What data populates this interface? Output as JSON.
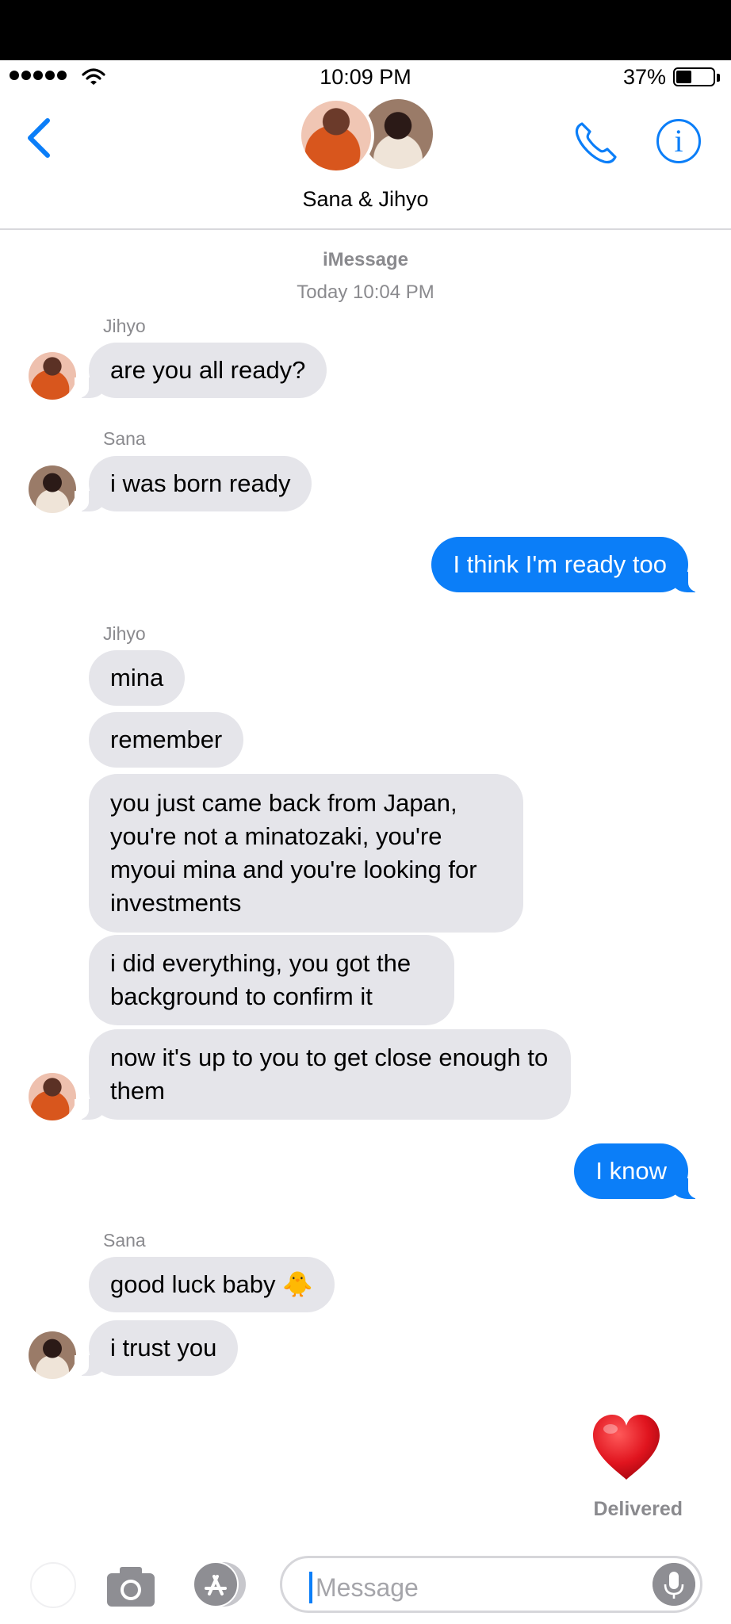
{
  "status_bar": {
    "time": "10:09 PM",
    "battery": "37%",
    "battery_level": 0.37
  },
  "nav": {
    "thread_name": "Sana & Jihyo"
  },
  "conversation": {
    "service": "iMessage",
    "timestamp": "Today 10:04 PM"
  },
  "messages": [
    {
      "sender": "Jihyo",
      "direction": "incoming",
      "text": "are you all ready?"
    },
    {
      "sender": "Sana",
      "direction": "incoming",
      "text": "i was born ready"
    },
    {
      "sender": "Me",
      "direction": "outgoing",
      "text": "I think I'm ready too"
    },
    {
      "sender": "Jihyo",
      "direction": "incoming",
      "text": "mina"
    },
    {
      "sender": "Jihyo",
      "direction": "incoming",
      "text": "remember"
    },
    {
      "sender": "Jihyo",
      "direction": "incoming",
      "text": "you just came back from Japan, you're not a minatozaki, you're myoui mina and you're looking for investments"
    },
    {
      "sender": "Jihyo",
      "direction": "incoming",
      "text": "i did everything, you got the background to confirm it"
    },
    {
      "sender": "Jihyo",
      "direction": "incoming",
      "text": "now it's up to you to get close enough to them"
    },
    {
      "sender": "Me",
      "direction": "outgoing",
      "text": "I know"
    },
    {
      "sender": "Sana",
      "direction": "incoming",
      "text": "good luck baby 🐥"
    },
    {
      "sender": "Sana",
      "direction": "incoming",
      "text": "i trust you"
    },
    {
      "sender": "Me",
      "direction": "outgoing",
      "text": "❤️",
      "emoji_only": true
    }
  ],
  "sender_labels": {
    "jihyo": "Jihyo",
    "sana": "Sana"
  },
  "delivery_status": "Delivered",
  "composer": {
    "placeholder": "Message"
  },
  "icons": [
    "back-chevron-icon",
    "phone-icon",
    "info-icon",
    "camera-icon",
    "app-store-icon",
    "microphone-icon",
    "wifi-icon",
    "battery-icon"
  ],
  "colors": {
    "accent": "#0b7ef8",
    "incoming_bubble": "#e5e5ea",
    "heart": "#e0141e"
  }
}
